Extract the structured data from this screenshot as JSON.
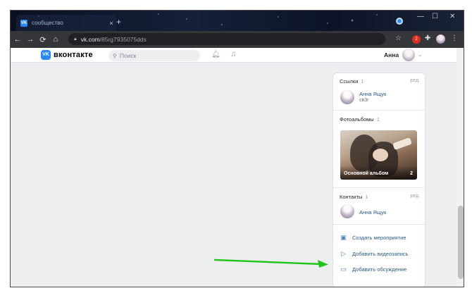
{
  "browser": {
    "tab": {
      "title": "сообщество",
      "favicon_text": "VK",
      "close": "×"
    },
    "new_tab": "+",
    "window_controls": {
      "minimize": "—",
      "maximize": "☐",
      "close": "✕"
    },
    "nav": {
      "back": "←",
      "forward": "→",
      "reload": "⟳",
      "home": "⌂"
    },
    "address": {
      "host": "vk.com",
      "path": "/85rg7935075dds"
    },
    "extension_badge": "2"
  },
  "header": {
    "logo_text": "VK",
    "brand": "вконтакте",
    "search_placeholder": "Поиск",
    "user_name": "Анна",
    "chevron": "⌄"
  },
  "sidebar": {
    "links": {
      "title": "Ссылки",
      "count": "1",
      "edit": "ред.",
      "item": {
        "name": "Анна Ящук",
        "sub": "св3г"
      }
    },
    "albums": {
      "title": "Фотоальбомы",
      "count": "1",
      "album": {
        "title": "Основной альбом",
        "count": "2"
      }
    },
    "contacts": {
      "title": "Контакты",
      "count": "1",
      "edit": "ред.",
      "item": {
        "name": "Анна Ящук"
      }
    },
    "actions": [
      {
        "label": "Создать мероприятие",
        "icon": "calendar-icon"
      },
      {
        "label": "Добавить видеозапись",
        "icon": "video-icon"
      },
      {
        "label": "Добавить обсуждение",
        "icon": "discussion-icon"
      }
    ]
  },
  "annotation": {
    "color": "#22c41a"
  }
}
